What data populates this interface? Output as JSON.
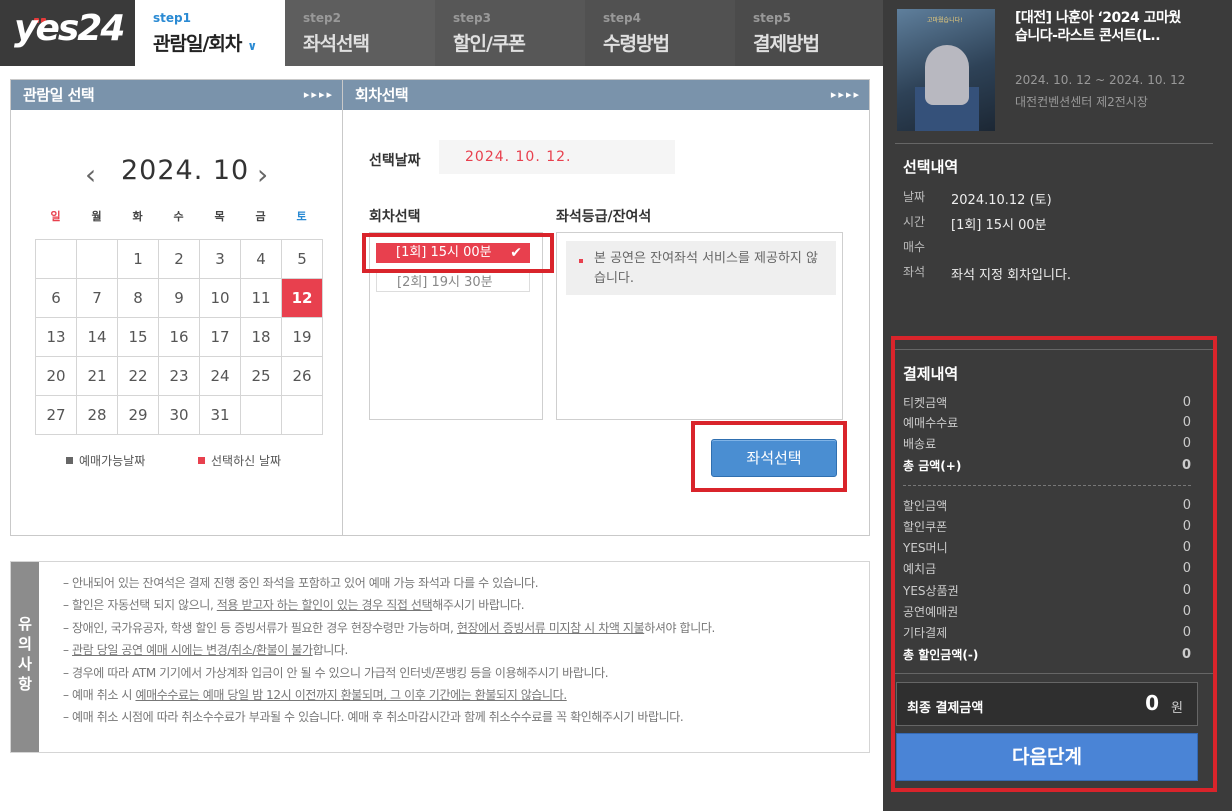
{
  "logo": {
    "text": "yes24"
  },
  "steps": [
    {
      "num": "step1",
      "label": "관람일/회차",
      "active": true
    },
    {
      "num": "step2",
      "label": "좌석선택"
    },
    {
      "num": "step3",
      "label": "할인/쿠폰"
    },
    {
      "num": "step4",
      "label": "수령방법"
    },
    {
      "num": "step5",
      "label": "결제방법"
    }
  ],
  "date_panel": {
    "title": "관람일 선택",
    "arrows": "▸▸▸▸",
    "month": "2024. 10",
    "weekdays": [
      "일",
      "월",
      "화",
      "수",
      "목",
      "금",
      "토"
    ],
    "weeks": [
      [
        "",
        "",
        "1",
        "2",
        "3",
        "4",
        "5"
      ],
      [
        "6",
        "7",
        "8",
        "9",
        "10",
        "11",
        "12"
      ],
      [
        "13",
        "14",
        "15",
        "16",
        "17",
        "18",
        "19"
      ],
      [
        "20",
        "21",
        "22",
        "23",
        "24",
        "25",
        "26"
      ],
      [
        "27",
        "28",
        "29",
        "30",
        "31",
        "",
        ""
      ]
    ],
    "selected_day": "12",
    "legend_available": "예매가능날짜",
    "legend_selected": "선택하신 날짜"
  },
  "round_panel": {
    "title": "회차선택",
    "arrows": "▸▸▸▸",
    "selected_date_label": "선택날짜",
    "selected_date_value": "2024. 10. 12.",
    "round_label": "회차선택",
    "seat_label": "좌석등급/잔여석",
    "rounds": [
      "[1회] 15시 00분",
      "[2회] 19시 30분"
    ],
    "seat_note": "본 공연은 잔여좌석 서비스를 제공하지 않습니다.",
    "seat_button": "좌석선택"
  },
  "notes": {
    "side_label": "유의사항",
    "items": [
      {
        "pre": "안내되어 있는 잔여석은 결제 진행 중인 좌석을 포함하고 있어 예매 가능 좌석과 다를 수 있습니다.",
        "u": "",
        "post": ""
      },
      {
        "pre": "할인은 자동선택 되지 않으니, ",
        "u": "적용 받고자 하는 할인이 있는 경우 직접 선택",
        "post": "해주시기 바랍니다."
      },
      {
        "pre": "장애인, 국가유공자, 학생 할인 등 증빙서류가 필요한 경우 현장수령만 가능하며, ",
        "u": "현장에서 증빙서류 미지참 시 차액 지불",
        "post": "하셔야 합니다."
      },
      {
        "pre": "",
        "u": "관람 당일 공연 예매 시에는 변경/취소/환불이 불가",
        "post": "합니다."
      },
      {
        "pre": "경우에 따라 ATM 기기에서 가상계좌 입금이 안 될 수 있으니 가급적 인터넷/폰뱅킹 등을 이용해주시기 바랍니다.",
        "u": "",
        "post": ""
      },
      {
        "pre": "예매 취소 시 ",
        "u": "예매수수료는 예매 당일 밤 12시 이전까지 환불되며, 그 이후 기간에는 환불되지 않습니다.",
        "post": ""
      },
      {
        "pre": "예매 취소 시점에 따라 취소수수료가 부과될 수 있습니다. 예매 후 취소마감시간과 함께 취소수수료를 꼭 확인해주시기 바랍니다.",
        "u": "",
        "post": ""
      }
    ]
  },
  "sidebar": {
    "poster_caption": "고마웠습니다!",
    "show_title": "[대전] 나훈아 ‘2024 고마웠습니다-라스트 콘서트(L..",
    "show_date": "2024. 10. 12 ~ 2024. 10. 12",
    "show_venue": "대전컨벤션센터 제2전시장",
    "selection_title": "선택내역",
    "selection_rows": [
      {
        "label": "날짜",
        "value": "2024.10.12 (토)"
      },
      {
        "label": "시간",
        "value": "[1회] 15시 00분"
      },
      {
        "label": "매수",
        "value": ""
      },
      {
        "label": "좌석",
        "value": "좌석 지정 회차입니다."
      }
    ],
    "payment_title": "결제내역",
    "payment_rows": [
      {
        "label": "티켓금액",
        "value": "0"
      },
      {
        "label": "예매수수료",
        "value": "0"
      },
      {
        "label": "배송료",
        "value": "0"
      },
      {
        "label": "총 금액(+)",
        "value": "0",
        "total": true
      }
    ],
    "discount_rows": [
      {
        "label": "할인금액",
        "value": "0"
      },
      {
        "label": "할인쿠폰",
        "value": "0"
      },
      {
        "label": "YES머니",
        "value": "0"
      },
      {
        "label": "예치금",
        "value": "0"
      },
      {
        "label": "YES상품권",
        "value": "0"
      },
      {
        "label": "공연예매권",
        "value": "0"
      },
      {
        "label": "기타결제",
        "value": "0"
      },
      {
        "label": "총 할인금액(-)",
        "value": "0",
        "total": true
      }
    ],
    "final_label": "최종 결제금액",
    "final_value": "0",
    "final_unit": "원",
    "next_button": "다음단계"
  },
  "colors": {
    "accent_red": "#e8404e",
    "button_blue": "#4a8ed2",
    "header_blue": "#7a93ab",
    "highlight_red": "#d9242b"
  }
}
